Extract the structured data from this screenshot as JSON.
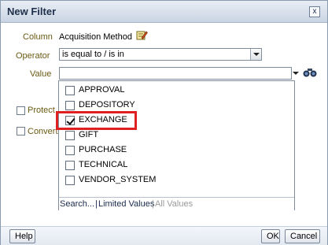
{
  "dialog": {
    "title": "New Filter",
    "close_glyph": "x"
  },
  "form": {
    "column_label": "Column",
    "column_value": "Acquisition Method",
    "operator_label": "Operator",
    "operator_value": "is equal to / is in",
    "value_label": "Value",
    "value_input": "",
    "protect_label": "Protect",
    "convert_label": "Convert"
  },
  "popup": {
    "items": [
      {
        "label": "APPROVAL",
        "checked": false
      },
      {
        "label": "DEPOSITORY",
        "checked": false
      },
      {
        "label": "EXCHANGE",
        "checked": true
      },
      {
        "label": "GIFT",
        "checked": false
      },
      {
        "label": "PURCHASE",
        "checked": false
      },
      {
        "label": "TECHNICAL",
        "checked": false
      },
      {
        "label": "VENDOR_SYSTEM",
        "checked": false
      }
    ],
    "footer": {
      "search": "Search...",
      "sep1": "|",
      "limited": "Limited Values",
      "sep2": "|",
      "all": "All Values"
    }
  },
  "buttons": {
    "help": "Help",
    "ok": "OK",
    "cancel": "Cancel"
  },
  "icons": {
    "edit": "edit-pencil-icon",
    "dropdown": "chevron-down-icon",
    "search": "binoculars-icon",
    "close": "close-icon"
  },
  "colors": {
    "label_text": "#6b5a12",
    "highlight_box": "#e02020",
    "titlebar_top": "#e9eef5",
    "titlebar_bottom": "#c9d4e3"
  }
}
